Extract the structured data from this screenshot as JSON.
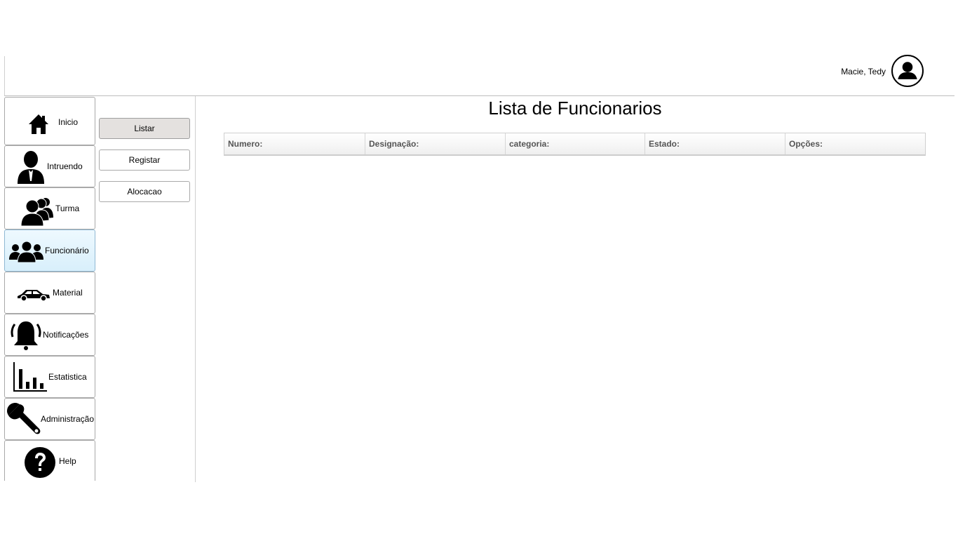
{
  "header": {
    "user_name": "Macie, Tedy",
    "avatar_icon": "user-avatar-icon"
  },
  "sidebar": {
    "items": [
      {
        "label": "Inicio",
        "icon": "home-icon"
      },
      {
        "label": "Intruendo",
        "icon": "student-icon"
      },
      {
        "label": "Turma",
        "icon": "group-icon"
      },
      {
        "label": "Funcionário",
        "icon": "staff-icon",
        "active": true
      },
      {
        "label": "Material",
        "icon": "car-icon"
      },
      {
        "label": "Notificações",
        "icon": "bell-icon"
      },
      {
        "label": "Estatistica",
        "icon": "bar-chart-icon"
      },
      {
        "label": "Administração",
        "icon": "wrench-icon"
      },
      {
        "label": "Help",
        "icon": "help-icon"
      }
    ]
  },
  "submenu": {
    "items": [
      {
        "label": "Listar",
        "active": true
      },
      {
        "label": "Registar"
      },
      {
        "label": "Alocacao"
      }
    ]
  },
  "main": {
    "title": "Lista de Funcionarios",
    "table": {
      "columns": [
        "Numero:",
        "Designação:",
        "categoria:",
        "Estado:",
        "Opções:"
      ],
      "rows": []
    }
  },
  "colors": {
    "active_nav_bg": "#d8effb",
    "active_submenu_bg": "#e4e1df",
    "header_text": "#555555"
  }
}
